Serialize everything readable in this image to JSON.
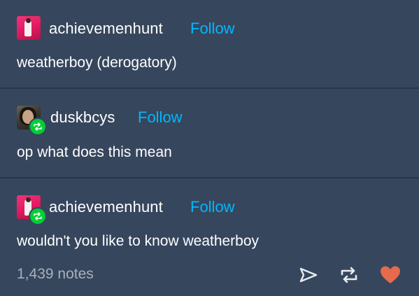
{
  "posts": [
    {
      "username": "achievemenhunt",
      "follow_label": "Follow",
      "text": "weatherboy (derogatory)",
      "avatar_icon": "avatar-pink-icon",
      "reblogged": false
    },
    {
      "username": "duskbcys",
      "follow_label": "Follow",
      "text": "op what does this mean",
      "avatar_icon": "avatar-photo-icon",
      "reblogged": true
    },
    {
      "username": "achievemenhunt",
      "follow_label": "Follow",
      "text": "wouldn't you like to know weatherboy",
      "avatar_icon": "avatar-pink-icon",
      "reblogged": true
    }
  ],
  "footer": {
    "notes": "1,439 notes",
    "icons": [
      "share-icon",
      "reblog-icon",
      "like-icon"
    ]
  },
  "colors": {
    "background": "#36465d",
    "follow": "#00b8ff",
    "reblog_badge": "#00cf35",
    "like": "#e66a4c",
    "notes_text": "#a7b0bd"
  }
}
